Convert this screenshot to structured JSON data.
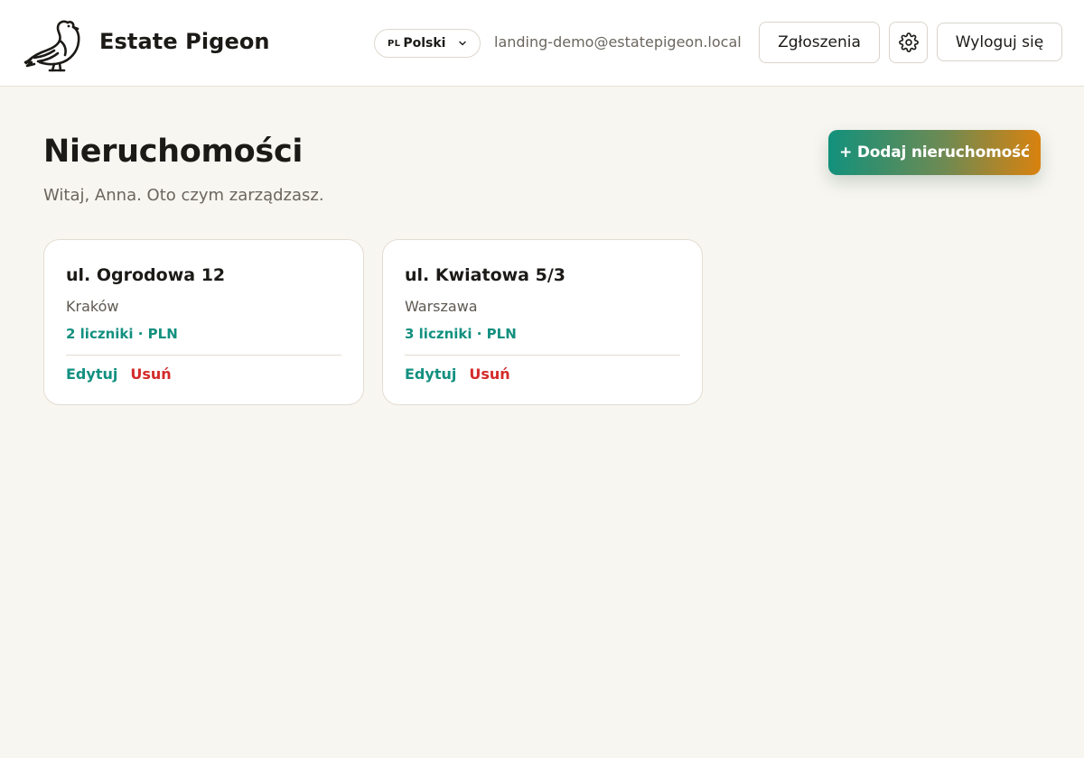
{
  "header": {
    "brand": "Estate Pigeon",
    "logo_icon": "pigeon-logo-icon",
    "language": {
      "code": "PL",
      "name": "Polski"
    },
    "user_email": "landing-demo@estatepigeon.local",
    "reports_label": "Zgłoszenia",
    "settings_icon": "gear-icon",
    "logout_label": "Wyloguj się"
  },
  "main": {
    "title": "Nieruchomości",
    "subtitle": "Witaj, Anna. Oto czym zarządzasz.",
    "add_button_label": "+ Dodaj nieruchomość"
  },
  "properties": [
    {
      "address": "ul. Ogrodowa 12",
      "city": "Kraków",
      "meta": "2 liczniki · PLN",
      "edit_label": "Edytuj",
      "delete_label": "Usuń"
    },
    {
      "address": "ul. Kwiatowa 5/3",
      "city": "Warszawa",
      "meta": "3 liczniki · PLN",
      "edit_label": "Edytuj",
      "delete_label": "Usuń"
    }
  ],
  "colors": {
    "accent_teal": "#129080",
    "accent_orange": "#d9820f",
    "danger": "#d42a2a",
    "background": "#f8f6f1"
  }
}
